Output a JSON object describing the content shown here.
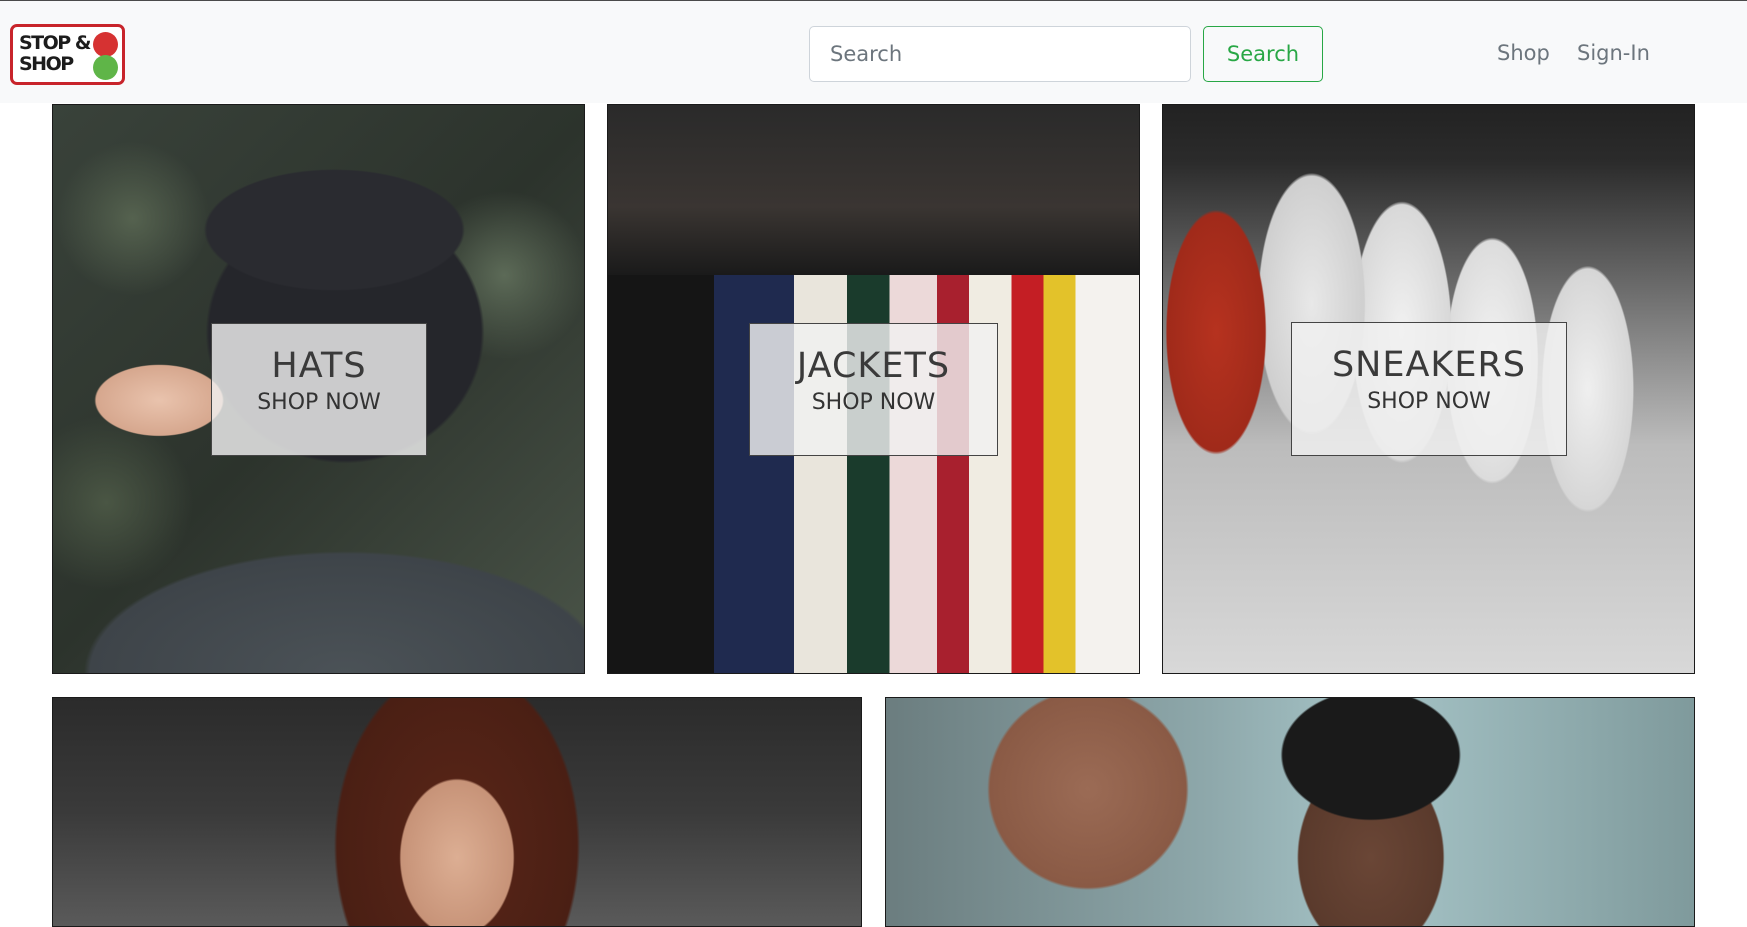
{
  "brand": {
    "logo_text": "STOP & SHOP"
  },
  "nav": {
    "search_placeholder": "Search",
    "search_button": "Search",
    "links": [
      {
        "label": "Shop"
      },
      {
        "label": "Sign-In"
      }
    ]
  },
  "categories": [
    {
      "title": "HATS",
      "cta": "SHOP NOW"
    },
    {
      "title": "JACKETS",
      "cta": "SHOP NOW"
    },
    {
      "title": "SNEAKERS",
      "cta": "SHOP NOW"
    }
  ],
  "colors": {
    "logo_red": "#d63232",
    "logo_green": "#5fb548",
    "search_button": "#28a745",
    "navbar_bg": "#f8f9fa"
  }
}
